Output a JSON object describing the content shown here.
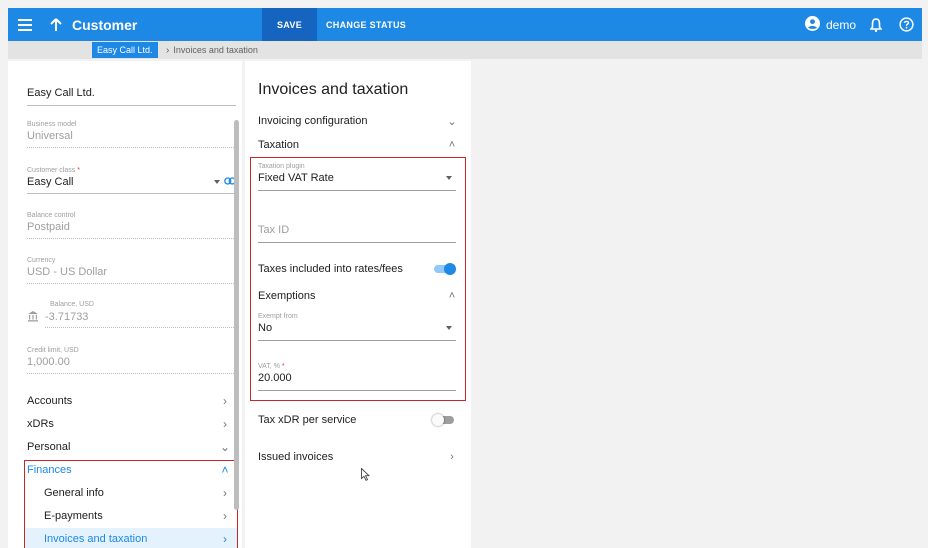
{
  "header": {
    "title": "Customer",
    "save_label": "SAVE",
    "change_status_label": "CHANGE STATUS",
    "user": "demo"
  },
  "breadcrumb": {
    "parent": "Easy Call Ltd.",
    "current": "Invoices and taxation"
  },
  "left": {
    "customer_name": "Easy Call Ltd.",
    "business_model": {
      "label": "Business model",
      "value": "Universal"
    },
    "customer_class": {
      "label": "Customer class",
      "required": "*",
      "value": "Easy Call"
    },
    "balance_control": {
      "label": "Balance control",
      "value": "Postpaid"
    },
    "currency": {
      "label": "Currency",
      "value": "USD - US Dollar"
    },
    "balance": {
      "label": "Balance, USD",
      "value": "-3.71733"
    },
    "credit_limit": {
      "label": "Credit limit, USD",
      "value": "1,000.00"
    },
    "nav": [
      {
        "label": "Accounts"
      },
      {
        "label": "xDRs"
      },
      {
        "label": "Personal"
      },
      {
        "label": "Finances"
      },
      {
        "label": "General info"
      },
      {
        "label": "E-payments"
      },
      {
        "label": "Invoices and taxation"
      }
    ]
  },
  "main": {
    "title": "Invoices and taxation",
    "invoicing_configuration": "Invoicing configuration",
    "taxation": "Taxation",
    "taxation_plugin": {
      "label": "Taxation plugin",
      "value": "Fixed VAT Rate"
    },
    "tax_id": {
      "placeholder": "Tax ID"
    },
    "taxes_included": {
      "label": "Taxes included into rates/fees",
      "on": true
    },
    "exemptions": "Exemptions",
    "exempt_from": {
      "label": "Exempt from",
      "value": "No"
    },
    "vat": {
      "label": "VAT, %",
      "required": "*",
      "value": "20.000"
    },
    "tax_xdr": {
      "label": "Tax xDR per service",
      "on": false
    },
    "issued_invoices": "Issued invoices"
  },
  "colors": {
    "primary": "#1e88e5",
    "highlight_border": "#c62828",
    "selected_bg": "#e3f2fd"
  },
  "icons": [
    "menu-icon",
    "arrow-up-icon",
    "account-circle-icon",
    "bell-icon",
    "help-icon",
    "link-icon",
    "bank-icon",
    "chevron-right-icon",
    "chevron-down-icon",
    "chevron-up-icon",
    "mouse-cursor-icon"
  ]
}
